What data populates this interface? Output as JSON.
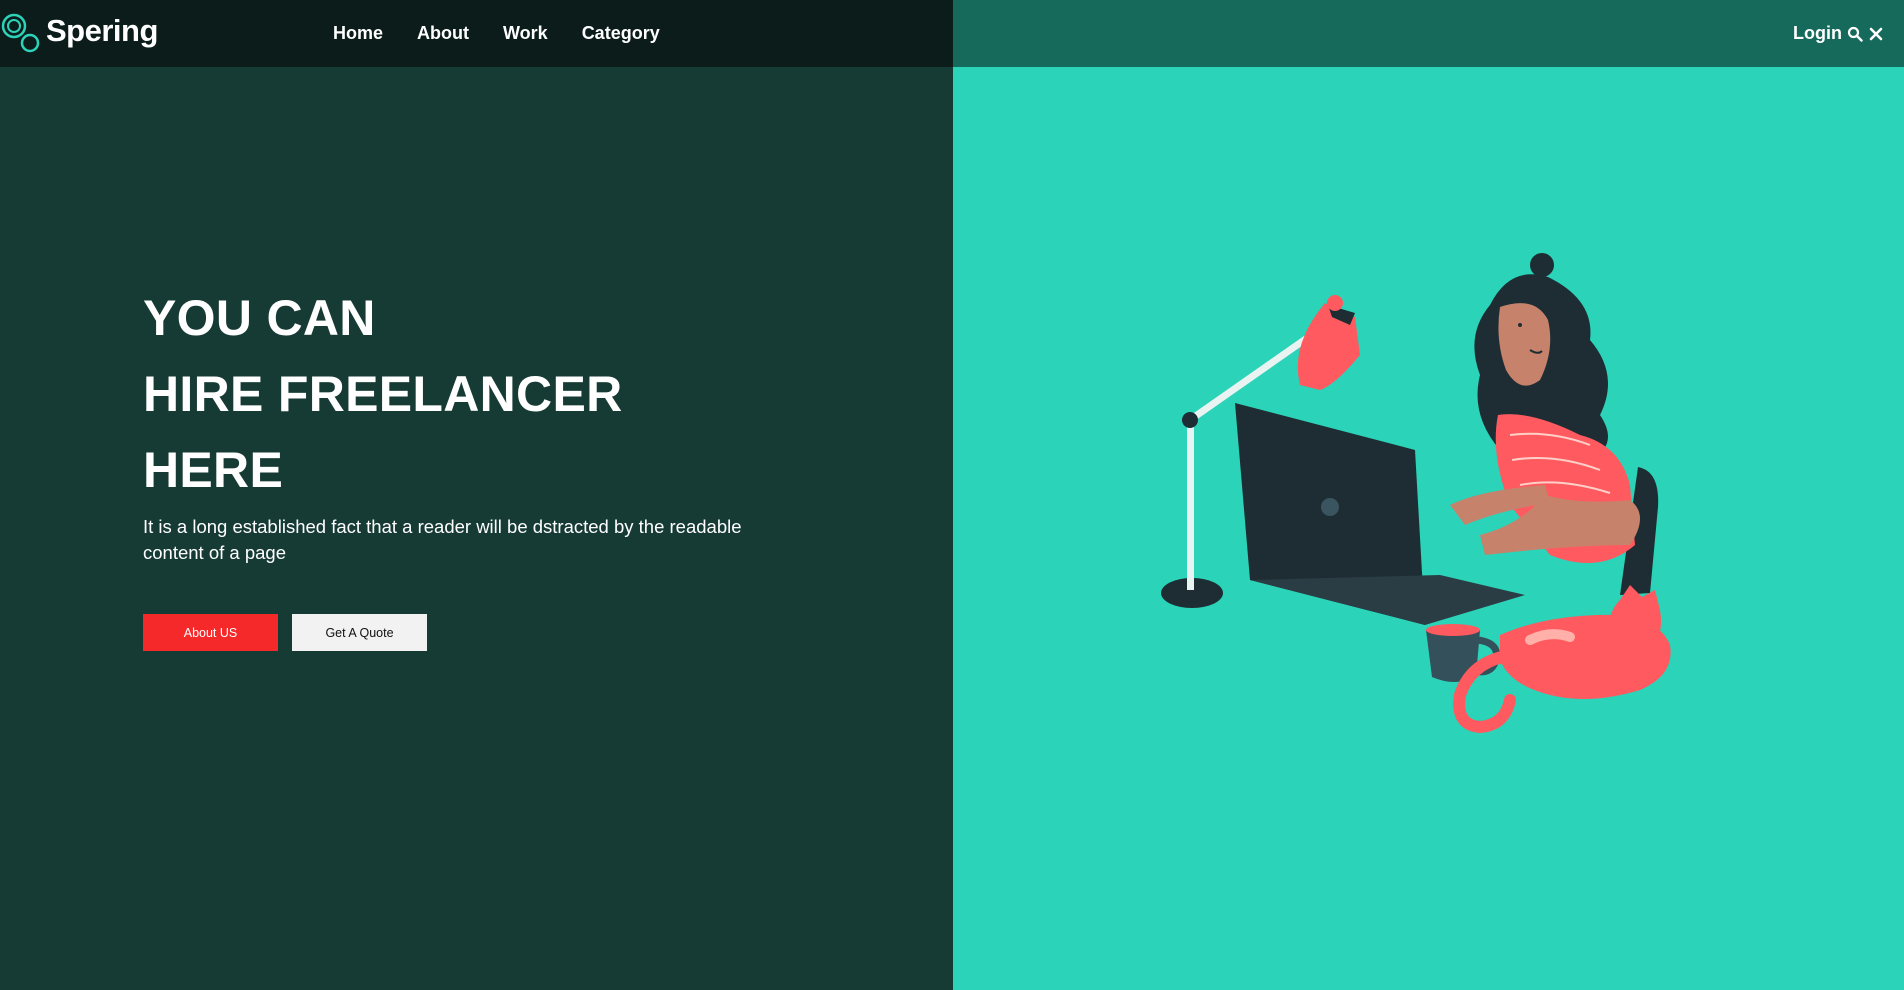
{
  "brand": {
    "name": "Spering",
    "logo_icon": "double-ring-logo-icon",
    "accent": "#2bd3b8"
  },
  "nav": {
    "items": [
      {
        "label": "Home"
      },
      {
        "label": "About"
      },
      {
        "label": "Work"
      },
      {
        "label": "Category"
      }
    ],
    "login_label": "Login",
    "search_icon": "search-icon",
    "close_icon": "close-icon"
  },
  "hero": {
    "lines": [
      "YOU CAN",
      "HIRE FREELANCER",
      "HERE"
    ],
    "description": "It is a long established fact that a reader will be dstracted by the readable content of a page",
    "primary_button": "About US",
    "secondary_button": "Get A Quote"
  },
  "illustration": {
    "icon": "freelancer-at-laptop-illustration"
  },
  "colors": {
    "dark_panel": "#163b35",
    "nav_dark": "#0b1c1b",
    "nav_teal": "#156a5c",
    "teal_panel": "#2bd3b8",
    "red_button": "#f5282a",
    "coral": "#ff5a5f"
  }
}
